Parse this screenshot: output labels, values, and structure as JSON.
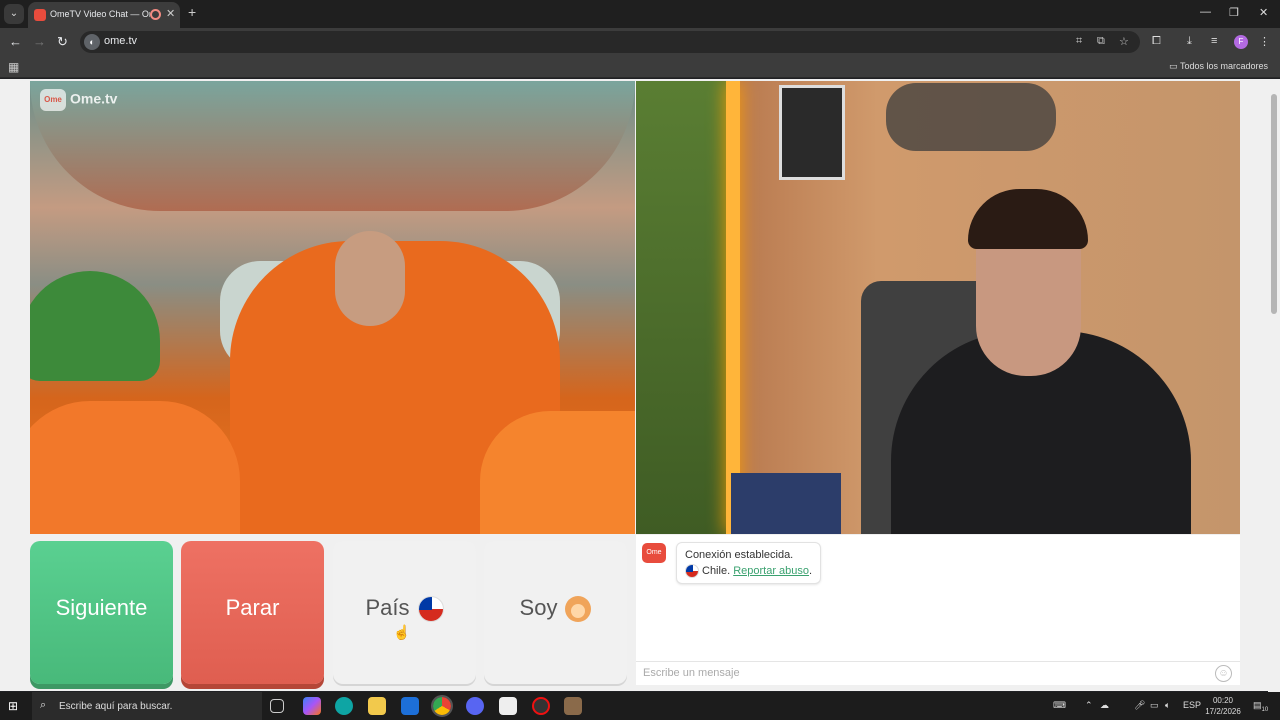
{
  "browser": {
    "tab_title": "OmeTV Video Chat — Ome",
    "url": "ome.tv",
    "profile_initial": "F",
    "bookmarks_all": "Todos los marcadores"
  },
  "video": {
    "logo_text": "Ome.tv"
  },
  "controls": {
    "next_label": "Siguiente",
    "stop_label": "Parar",
    "country_label": "País",
    "gender_label": "Soy"
  },
  "chat": {
    "system_message": "Conexión establecida.",
    "country": "Chile.",
    "report_link": "Reportar abuso",
    "report_suffix": ".",
    "input_placeholder": "Escribe un mensaje"
  },
  "taskbar": {
    "search_placeholder": "Escribe aquí para buscar.",
    "language": "ESP",
    "time": "00:20",
    "date": "17/2/2026",
    "notification_count": "10"
  },
  "colors": {
    "next": "#4fc686",
    "stop": "#e5675a",
    "accent_link": "#3aa16f"
  }
}
